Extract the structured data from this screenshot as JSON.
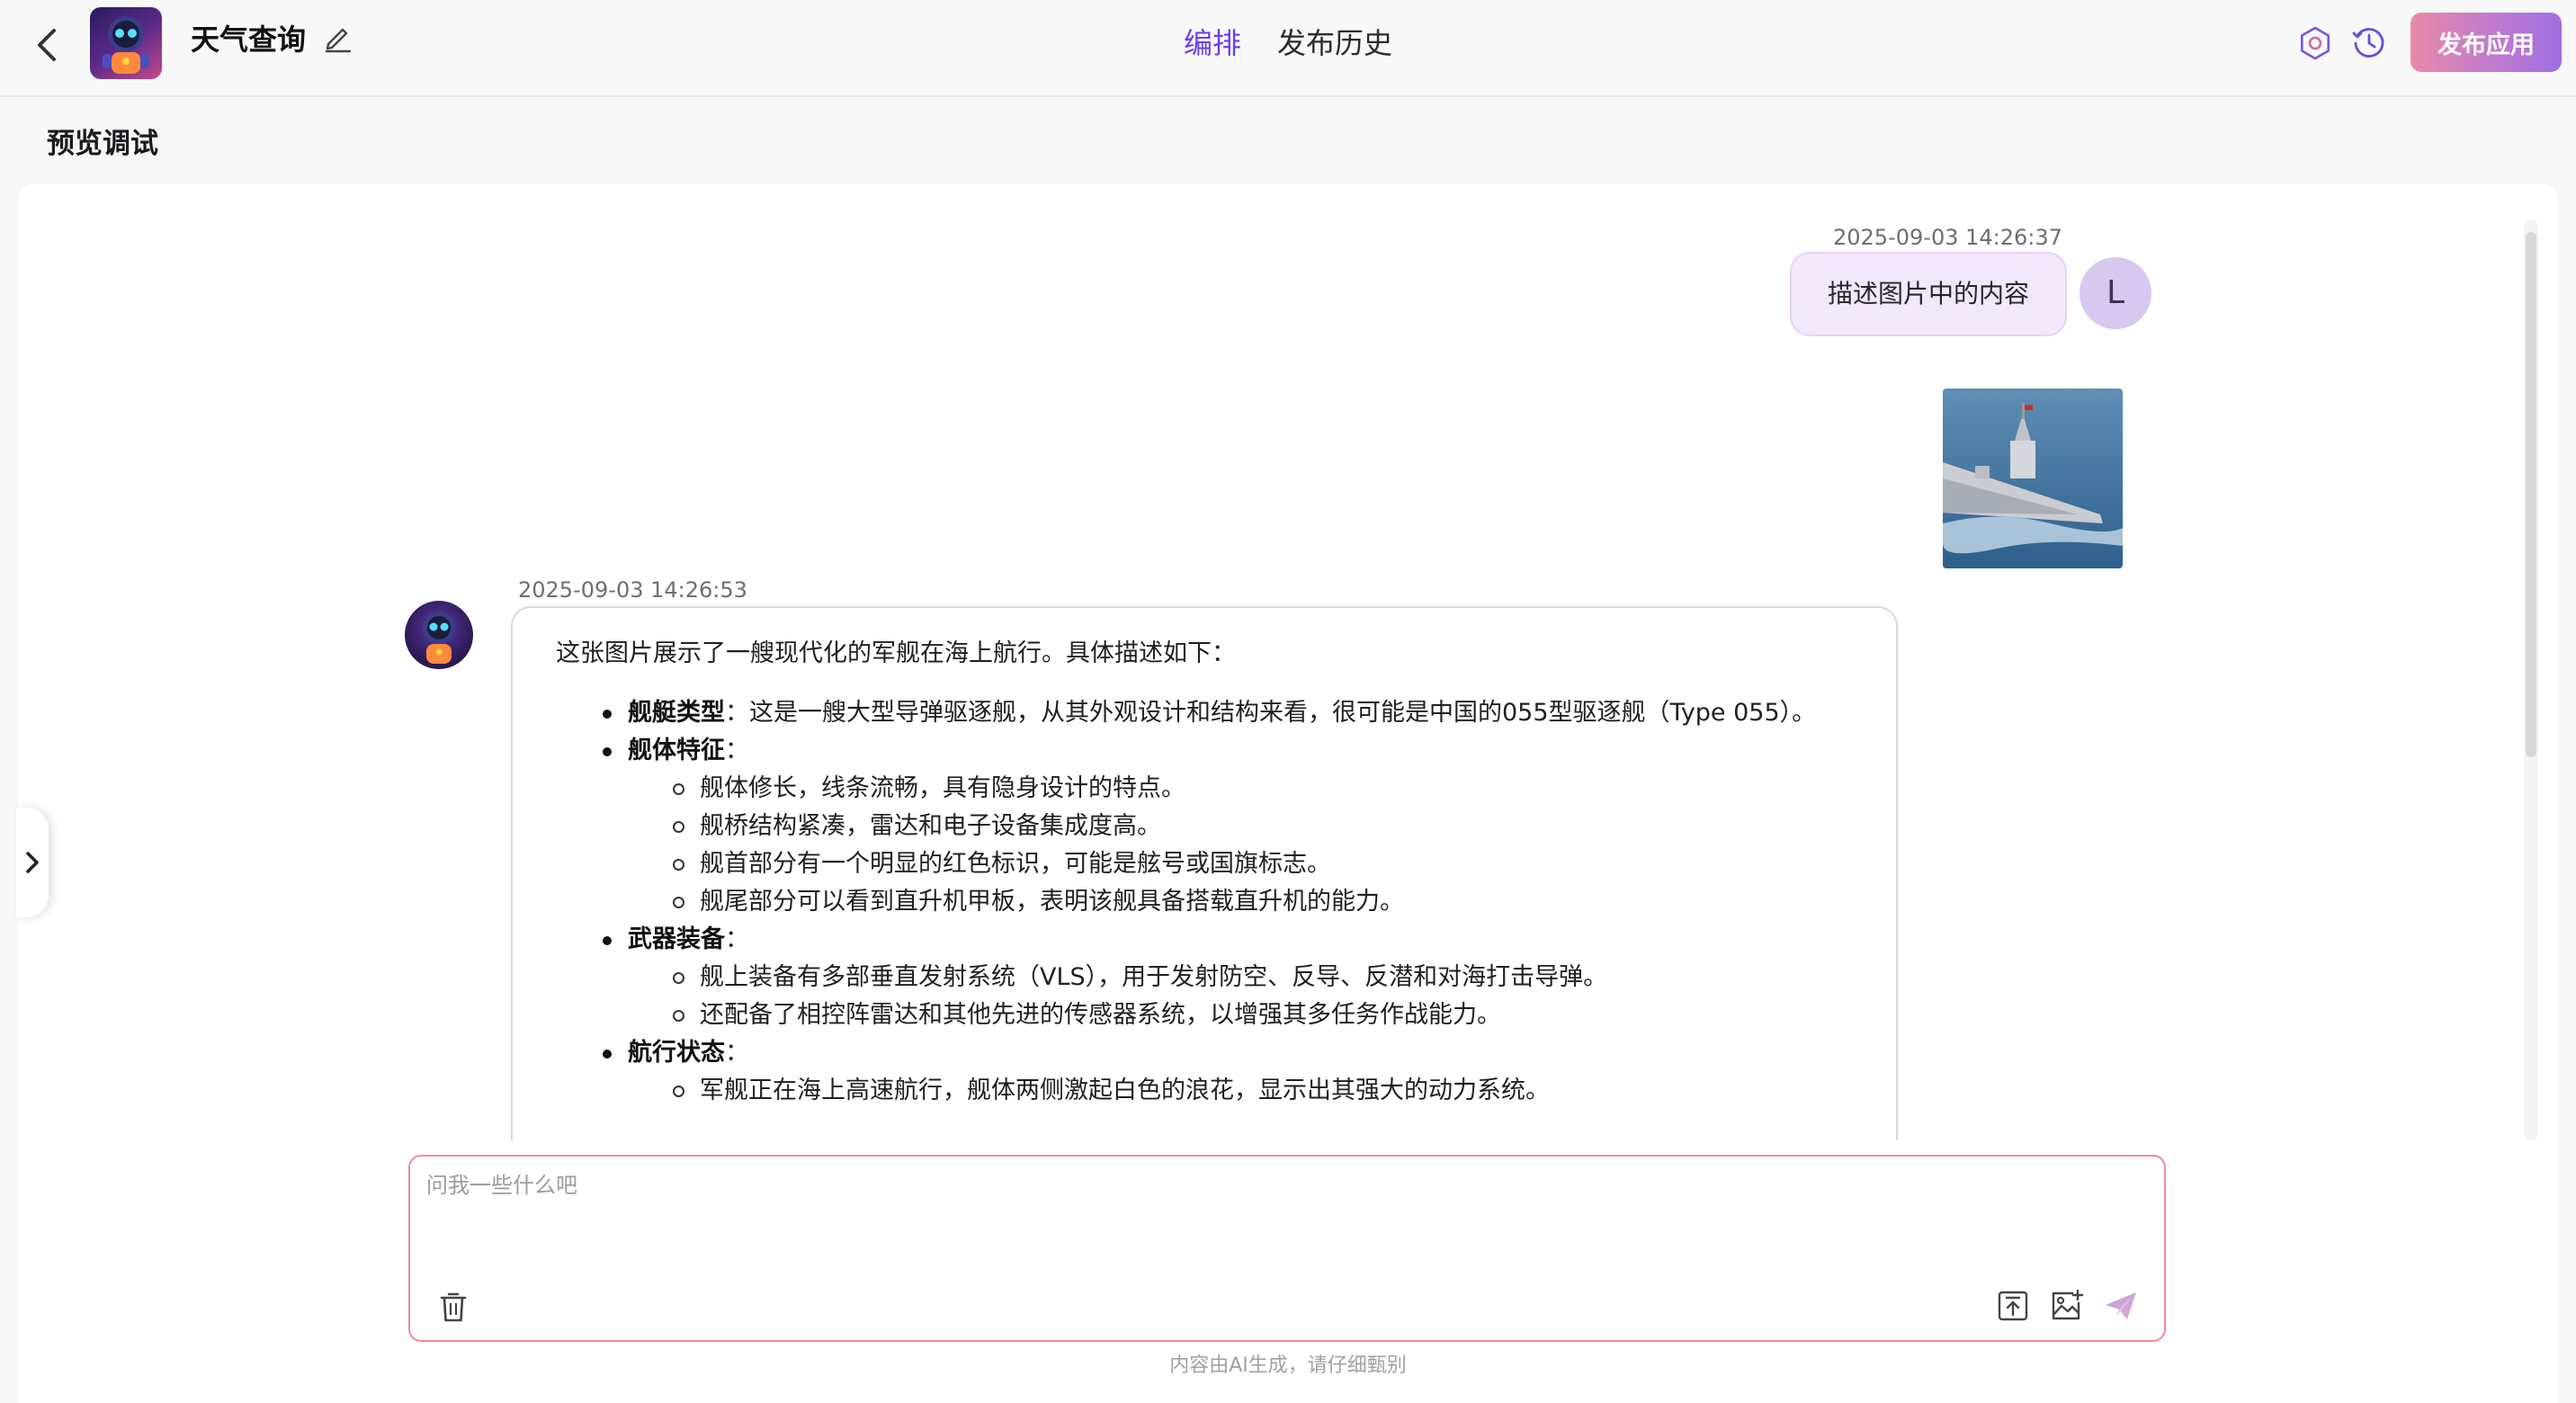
{
  "header": {
    "app_name": "天气查询",
    "tabs": [
      {
        "label": "编排",
        "active": true
      },
      {
        "label": "发布历史",
        "active": false
      }
    ],
    "publish_label": "发布应用",
    "icons": [
      "back-chevron-icon",
      "edit-pencil-icon",
      "settings-gear-icon",
      "history-clock-icon"
    ]
  },
  "page": {
    "section_title": "预览调试"
  },
  "chat": {
    "user_message": {
      "timestamp": "2025-09-03 14:26:37",
      "text": "描述图片中的内容",
      "avatar_letter": "L"
    },
    "bot_message": {
      "timestamp": "2025-09-03 14:26:53",
      "intro": "这张图片展示了一艘现代化的军舰在海上航行。具体描述如下：",
      "sections": [
        {
          "title": "舰艇类型",
          "text": "：这是一艘大型导弹驱逐舰，从其外观设计和结构来看，很可能是中国的055型驱逐舰（Type 055）。",
          "items": []
        },
        {
          "title": "舰体特征",
          "text": "：",
          "items": [
            "舰体修长，线条流畅，具有隐身设计的特点。",
            "舰桥结构紧凑，雷达和电子设备集成度高。",
            "舰首部分有一个明显的红色标识，可能是舷号或国旗标志。",
            "舰尾部分可以看到直升机甲板，表明该舰具备搭载直升机的能力。"
          ]
        },
        {
          "title": "武器装备",
          "text": "：",
          "items": [
            "舰上装备有多部垂直发射系统（VLS），用于发射防空、反导、反潜和对海打击导弹。",
            "还配备了相控阵雷达和其他先进的传感器系统，以增强其多任务作战能力。"
          ]
        },
        {
          "title": "航行状态",
          "text": "：",
          "items": [
            "军舰正在海上高速航行，舰体两侧激起白色的浪花，显示出其强大的动力系统。"
          ]
        }
      ]
    }
  },
  "input": {
    "placeholder": "问我一些什么吧",
    "value": ""
  },
  "footer": {
    "note": "内容由AI生成，请仔细甄别"
  },
  "colors": {
    "accent": "#6a3de8",
    "publish_gradient_start": "#e98aa6",
    "publish_gradient_end": "#9f6fe0",
    "input_border": "#ef8a9a",
    "user_bubble": "#f1e8fb"
  }
}
